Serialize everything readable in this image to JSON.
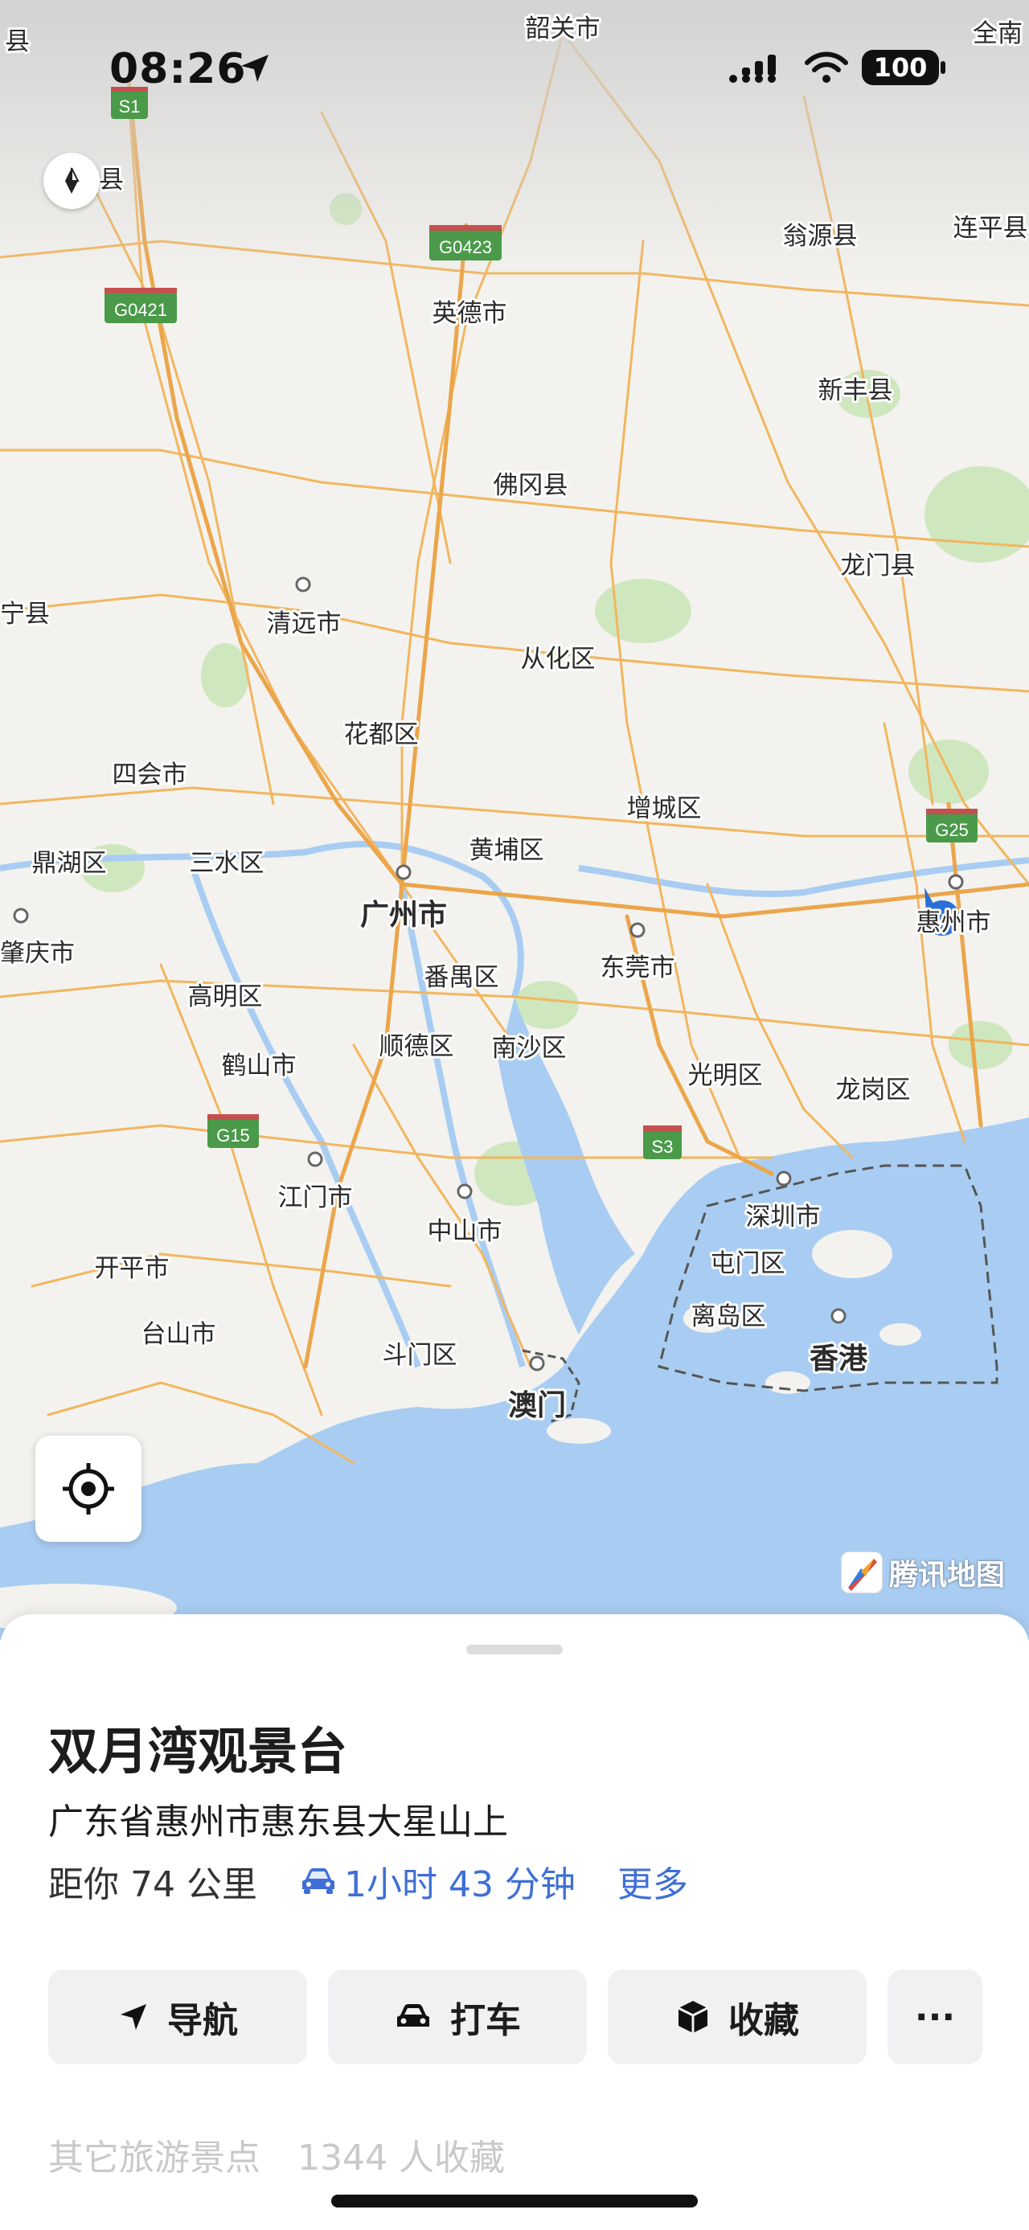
{
  "status_bar": {
    "time": "08:26",
    "battery": "100"
  },
  "map": {
    "provider_brand": "腾讯地图",
    "colors": {
      "land": "#f3f2ee",
      "water": "#a9cdf2",
      "green": "#c8e6b8",
      "road": "#f2b65f",
      "highway": "#f0a840",
      "label": "#2b2b2b",
      "current_location": "#2c6fd8"
    },
    "labels": {
      "shaoguan": "韶关市",
      "quannan": "全南",
      "xian_left_top": "县",
      "renhua_partial": "山县",
      "wengyuan": "翁源县",
      "lianping": "连平县",
      "yingde": "英德市",
      "xinfeng": "新丰县",
      "fogang": "佛冈县",
      "longmen": "龙门县",
      "ning_partial": "宁县",
      "qingyuan": "清远市",
      "conghua": "从化区",
      "huadu": "花都区",
      "sihui": "四会市",
      "zengcheng": "增城区",
      "dinghu": "鼎湖区",
      "sanshui": "三水区",
      "huangpu": "黄埔区",
      "guangzhou": "广州市",
      "zhaoqing_partial": "肇庆市",
      "gaoming": "高明区",
      "panyu": "番禺区",
      "dongguan": "东莞市",
      "huizhou": "惠州市",
      "heshan": "鹤山市",
      "shunde": "顺德区",
      "nansha": "南沙区",
      "guangming": "光明区",
      "longgang": "龙岗区",
      "jiangmen": "江门市",
      "zhongshan": "中山市",
      "shenzhen": "深圳市",
      "kaiping": "开平市",
      "tuen_mun": "屯门区",
      "islands": "离岛区",
      "taishan": "台山市",
      "doumen": "斗门区",
      "hong_kong": "香港",
      "macau": "澳门"
    },
    "road_shields": {
      "s1": "S1",
      "g0423": "G0423",
      "g0421": "G0421",
      "g25": "G25",
      "g15": "G15",
      "s3": "S3"
    }
  },
  "place_card": {
    "title": "双月湾观景台",
    "address": "广东省惠州市惠东县大星山上",
    "distance": "距你 74 公里",
    "drive_time": "1小时 43 分钟",
    "more": "更多",
    "actions": {
      "navigate": "导航",
      "taxi": "打车",
      "favorite": "收藏",
      "more": "···"
    },
    "footer": {
      "category": "其它旅游景点",
      "favorites_count": "1344 人收藏"
    }
  }
}
